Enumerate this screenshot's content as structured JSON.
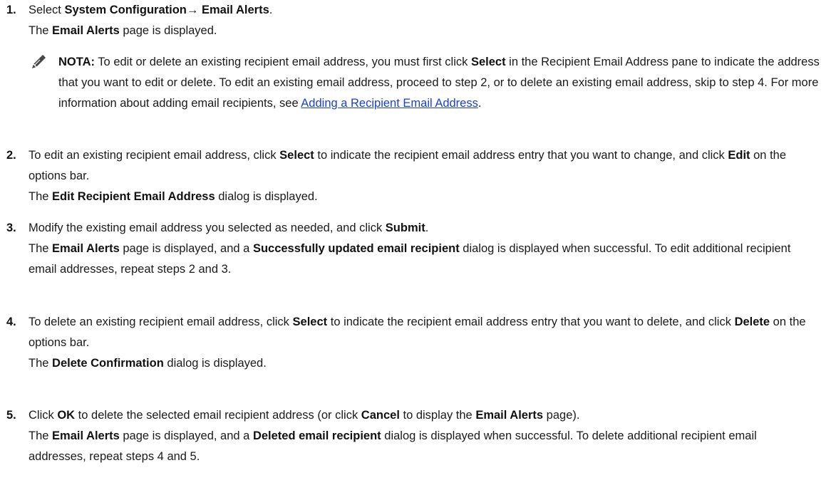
{
  "steps": [
    {
      "number": "1.",
      "line1": {
        "pre": "Select ",
        "b1": "System Configuration",
        "arrow": "→ ",
        "b2": "Email Alerts",
        "post": "."
      },
      "line2": {
        "pre": "The ",
        "b1": "Email Alerts",
        "post": " page is displayed."
      }
    },
    {
      "number": "2.",
      "para1": {
        "t1": "To edit an existing recipient email address, click ",
        "b1": "Select",
        "t2": " to indicate the recipient email address entry that you want to change, and click ",
        "b2": "Edit",
        "t3": " on the options bar."
      },
      "para2": {
        "t1": "The ",
        "b1": "Edit Recipient Email Address",
        "t2": " dialog is displayed."
      }
    },
    {
      "number": "3.",
      "para1": {
        "t1": "Modify the existing email address you selected as needed, and click ",
        "b1": "Submit",
        "t2": "."
      },
      "para2": {
        "t1": "The ",
        "b1": "Email Alerts",
        "t2": " page is displayed, and a ",
        "b2": "Successfully updated email recipient",
        "t3": " dialog is displayed when successful. To edit additional recipient email addresses, repeat steps 2 and 3."
      }
    },
    {
      "number": "4.",
      "para1": {
        "t1": "To delete an existing recipient email address, click ",
        "b1": "Select",
        "t2": " to indicate the recipient email address entry that you want to delete, and click ",
        "b2": "Delete",
        "t3": " on the options bar."
      },
      "para2": {
        "t1": "The ",
        "b1": "Delete Confirmation",
        "t2": " dialog is displayed."
      }
    },
    {
      "number": "5.",
      "para1": {
        "t1": "Click ",
        "b1": "OK",
        "t2": " to delete the selected email recipient address (or click ",
        "b2": "Cancel",
        "t3": " to display the ",
        "b3": "Email Alerts",
        "t4": " page)."
      },
      "para2": {
        "t1": "The ",
        "b1": "Email Alerts",
        "t2": " page is displayed, and a ",
        "b2": "Deleted email recipient",
        "t3": " dialog is displayed when successful. To delete additional recipient email addresses, repeat steps 4 and 5."
      }
    }
  ],
  "note": {
    "icon": "pencil-note-icon",
    "label": "NOTA:",
    "t1": " To edit or delete an existing recipient email address, you must first click ",
    "b1": "Select",
    "t2": " in the Recipient Email Address pane to indicate the address that you want to edit or delete. To edit an existing email address, proceed to step 2, or to delete an existing email address, skip to step 4. For more information about adding email recipients, see ",
    "link": "Adding a Recipient Email Address",
    "t3": "."
  },
  "colors": {
    "text": "#1a1a1a",
    "link": "#1a3fd6",
    "icon": "#444444"
  }
}
